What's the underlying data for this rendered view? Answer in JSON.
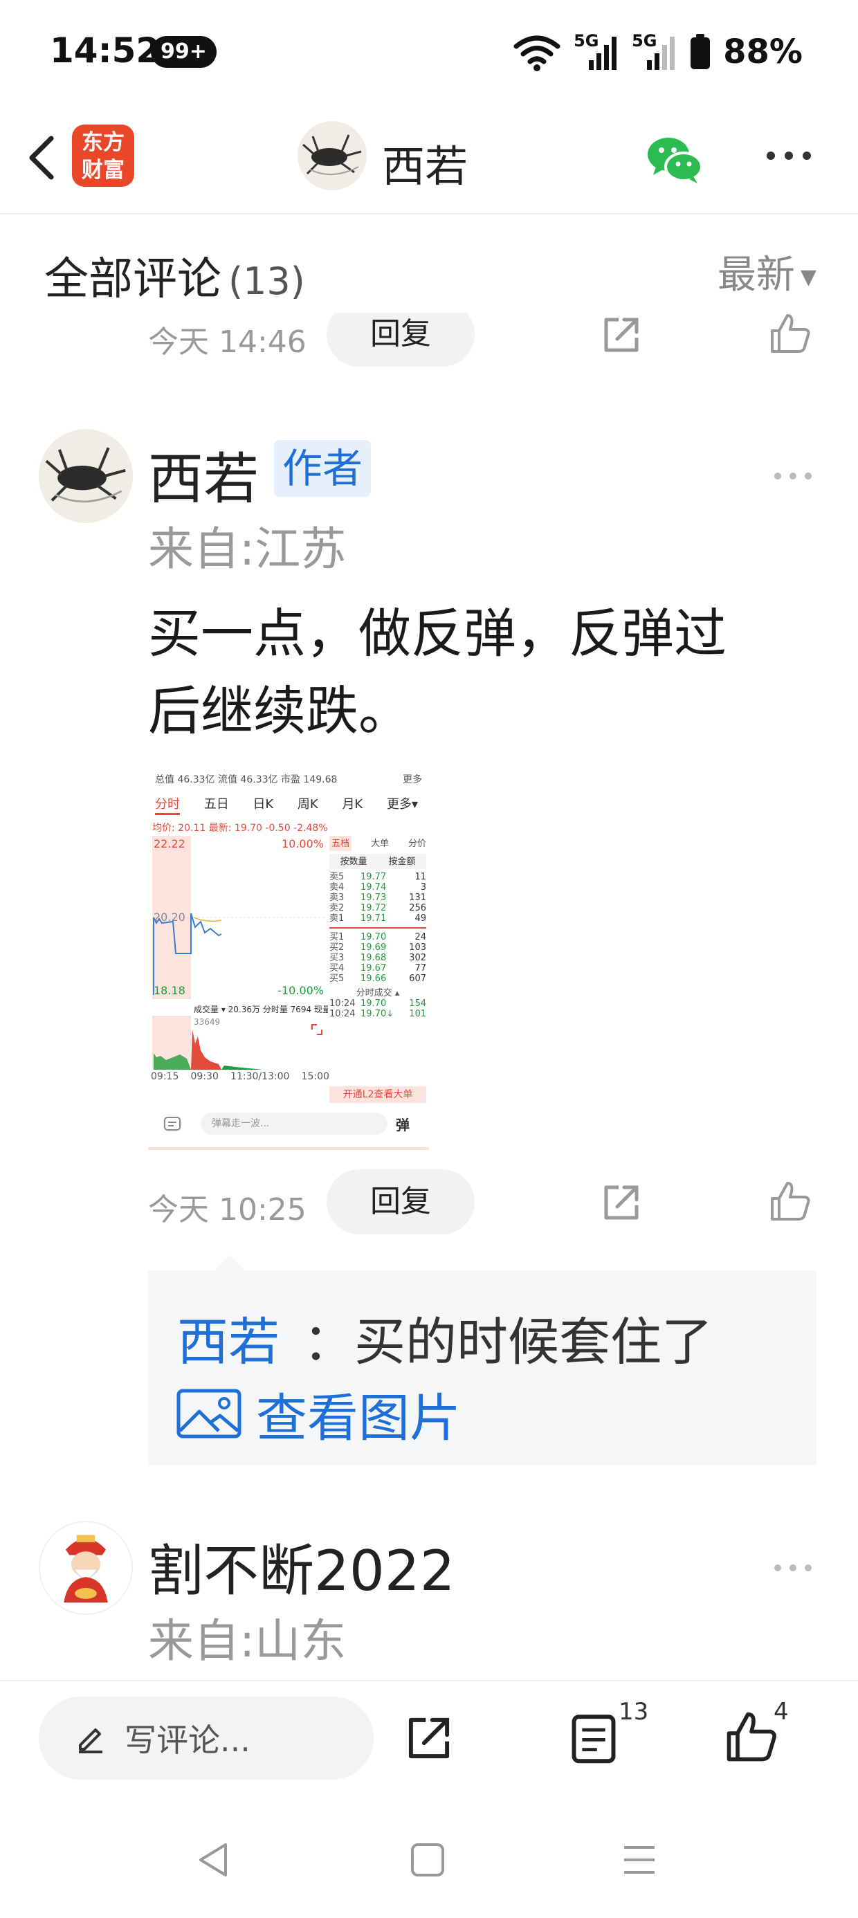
{
  "status_bar": {
    "time": "14:52",
    "notification_badge": "99+",
    "battery": "88%",
    "network_1": "5G",
    "network_2": "5G"
  },
  "header": {
    "app_logo_text_1": "东方",
    "app_logo_text_2": "财富",
    "title": "西若",
    "icons": [
      "back-icon",
      "wechat-icon",
      "more-icon"
    ]
  },
  "comments_header": {
    "title": "全部评论",
    "count": "(13)",
    "sort_label": "最新",
    "sort_arrow": "▼"
  },
  "previous_comment_actions": {
    "time": "今天 14:46",
    "reply_label": "回复"
  },
  "comment_1": {
    "username": "西若",
    "badge": "作者",
    "location": "来自:江苏",
    "text_line_1": "买一点，做反弹，反弹过",
    "text_line_2": "后继续跌。",
    "time": "今天 10:25",
    "reply_label": "回复",
    "image": {
      "top_stats": "总值 46.33亿  流值 46.33亿  市盈 149.68",
      "top_more": "更多",
      "tabs": [
        "分时",
        "五日",
        "日K",
        "周K",
        "月K",
        "更多▾"
      ],
      "avg_row": "均价: 20.11  最新: 19.70  -0.50  -2.48%",
      "price_high": "22.22",
      "price_mid": "20.20",
      "price_low": "18.18",
      "pct_high": "10.00%",
      "pct_low": "-10.00%",
      "order_tabs": [
        "五档",
        "大单",
        "分价"
      ],
      "order_sub_tabs": [
        "按数量",
        "按金额"
      ],
      "sell_orders": [
        {
          "label": "卖5",
          "price": "19.77",
          "vol": "11"
        },
        {
          "label": "卖4",
          "price": "19.74",
          "vol": "3"
        },
        {
          "label": "卖3",
          "price": "19.73",
          "vol": "131"
        },
        {
          "label": "卖2",
          "price": "19.72",
          "vol": "256"
        },
        {
          "label": "卖1",
          "price": "19.71",
          "vol": "49"
        }
      ],
      "buy_orders": [
        {
          "label": "买1",
          "price": "19.70",
          "vol": "24"
        },
        {
          "label": "买2",
          "price": "19.69",
          "vol": "103"
        },
        {
          "label": "买3",
          "price": "19.68",
          "vol": "302"
        },
        {
          "label": "买4",
          "price": "19.67",
          "vol": "77"
        },
        {
          "label": "买5",
          "price": "19.66",
          "vol": "607"
        }
      ],
      "volume_label": "成交量 ▾  20.36万  分时量 7694  现量 154",
      "volume_value": "33649",
      "time_axis": [
        "09:15",
        "09:30",
        "11:30/13:00",
        "15:00"
      ],
      "ticks_header": "分时成交 ▴",
      "ticks": [
        {
          "time": "10:24",
          "price": "19.70",
          "vol": "154"
        },
        {
          "time": "10:24",
          "price": "19.70↓",
          "vol": "101"
        }
      ],
      "l2_banner": "开通L2查看大单",
      "danmu_placeholder": "弹幕走一波...",
      "danmu_button": "弹"
    }
  },
  "reply": {
    "author": "西若",
    "text": "：买的时候套住了",
    "view_image": "查看图片"
  },
  "comment_2": {
    "username": "割不断2022",
    "location": "来自:山东"
  },
  "bottom_bar": {
    "write_placeholder": "写评论...",
    "comment_count": "13",
    "like_count": "4"
  },
  "colors": {
    "accent_blue": "#1f6fd8",
    "logo_red": "#e9472a",
    "wechat_green": "#2bbb51",
    "stock_red": "#e24b3b",
    "stock_green": "#1e9c3b"
  }
}
